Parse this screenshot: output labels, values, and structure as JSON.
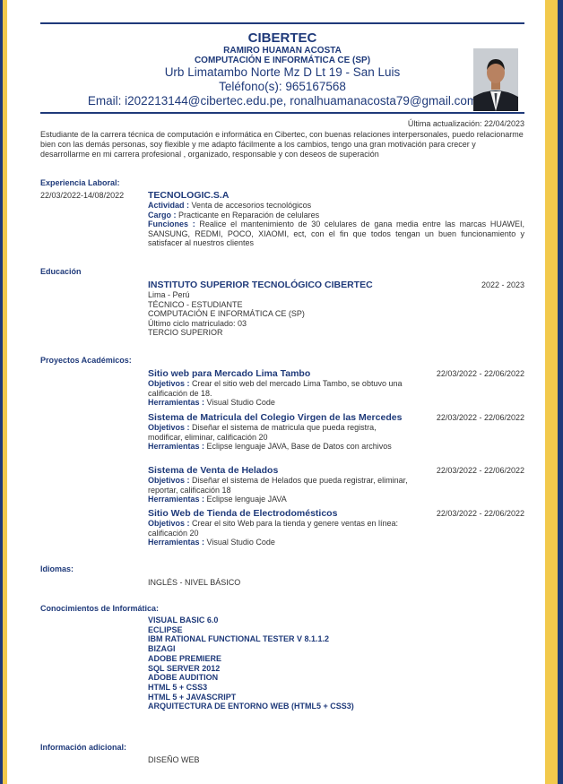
{
  "header": {
    "name": "CIBERTEC",
    "full_name": "RAMIRO HUAMAN ACOSTA",
    "degree": "COMPUTACIÓN E INFORMÁTICA CE (SP)",
    "address": "Urb Limatambo Norte Mz D Lt 19 - San Luis",
    "phone": "Teléfono(s): 965167568",
    "email": "Email: i202213144@cibertec.edu.pe, ronalhuamanacosta79@gmail.com"
  },
  "updated": "Última actualización: 22/04/2023",
  "intro": "Estudiante de la carrera técnica de computación e informática en Cibertec, con buenas relaciones interpersonales, puedo relacionarme bien con las demás personas, soy flexible y me adapto fácilmente a los cambios, tengo una gran motivación para crecer y desarrollarme en mi carrera profesional , organizado, responsable y con deseos de superación",
  "experience": {
    "title": "Experiencia Laboral:",
    "date": "22/03/2022-14/08/2022",
    "company": "TECNOLOGIC.S.A",
    "activity_label": "Actividad :",
    "activity": " Venta de accesorios tecnológicos",
    "role_label": "Cargo :",
    "role": " Practicante en Reparación de celulares",
    "functions_label": "Funciones :",
    "functions": " Realice el mantenimiento de 30 celulares de gana media entre las marcas HUAWEI, SANSUNG, REDMI, POCO, XIAOMI, ect, con el fin que todos tengan un buen funcionamiento y satisfacer al nuestros clientes"
  },
  "education": {
    "title": "Educación",
    "institution": "INSTITUTO SUPERIOR TECNOLÓGICO CIBERTEC",
    "years": "2022 - 2023",
    "lines": [
      "Lima - Perú",
      "TÉCNICO - ESTUDIANTE",
      "COMPUTACIÓN E INFORMÁTICA CE (SP)",
      "Último ciclo matriculado: 03",
      "TERCIO SUPERIOR"
    ]
  },
  "projects": {
    "title": "Proyectos Académicos:",
    "obj_label": "Objetivos :",
    "tools_label": "Herramientas :",
    "items": [
      {
        "name": "Sitio web para Mercado Lima Tambo",
        "dates": "22/03/2022 - 22/06/2022",
        "objective": " Crear el sitio web del mercado Lima Tambo, se obtuvo una calificación de 18.",
        "tools": " Visual Studio Code"
      },
      {
        "name": "Sistema de Matricula del Colegio Virgen de las Mercedes",
        "dates": "22/03/2022 - 22/06/2022",
        "objective": " Diseñar el sistema de matricula que pueda registra, modificar, eliminar, calificación 20",
        "tools": " Eclipse lenguaje JAVA, Base de Datos con archivos"
      },
      {
        "name": "Sistema de Venta de Helados",
        "dates": "22/03/2022 - 22/06/2022",
        "objective": " Diseñar el sistema de Helados que pueda registrar, eliminar, reportar, calificación 18",
        "tools": " Eclipse lenguaje JAVA"
      },
      {
        "name": "Sitio Web de Tienda de Electrodomésticos",
        "dates": "22/03/2022 - 22/06/2022",
        "objective": " Crear el sito Web para la tienda y genere ventas en línea: calificación 20",
        "tools": " Visual Studio Code"
      }
    ]
  },
  "languages": {
    "title": "Idiomas:",
    "value": "INGLÉS - NIVEL BÁSICO"
  },
  "skills": {
    "title": "Conocimientos de Informática:",
    "items": [
      "VISUAL BASIC 6.0",
      "ECLIPSE",
      "IBM RATIONAL FUNCTIONAL TESTER V 8.1.1.2",
      "BIZAGI",
      "ADOBE PREMIERE",
      "SQL SERVER 2012",
      "ADOBE AUDITION",
      "HTML 5 + CSS3",
      "HTML 5 + JAVASCRIPT",
      "ARQUITECTURA DE ENTORNO WEB (HTML5 + CSS3)"
    ]
  },
  "additional": {
    "title": "Información adicional:",
    "value": "DISEÑO WEB"
  },
  "colors": {
    "accent": "#1f3a7a",
    "gold": "#f2c94c"
  }
}
